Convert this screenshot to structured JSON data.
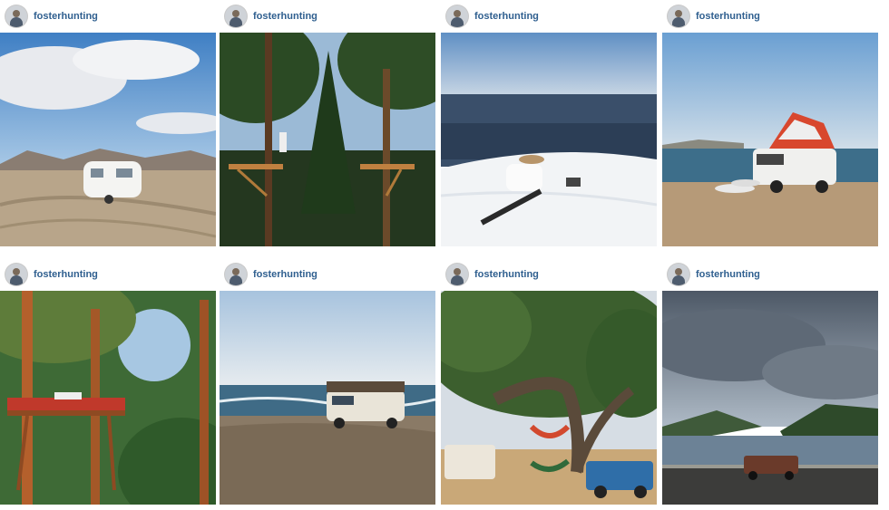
{
  "feed": {
    "posts": [
      {
        "username": "fosterhunting",
        "photo_subject": "vintage-camper-trailer"
      },
      {
        "username": "fosterhunting",
        "photo_subject": "treehouse-platforms"
      },
      {
        "username": "fosterhunting",
        "photo_subject": "snowboarder-on-summit"
      },
      {
        "username": "fosterhunting",
        "photo_subject": "van-rooftop-tent-beach"
      },
      {
        "username": "fosterhunting",
        "photo_subject": "forest-treehouse-deck"
      },
      {
        "username": "fosterhunting",
        "photo_subject": "vw-van-surf-beach"
      },
      {
        "username": "fosterhunting",
        "photo_subject": "hammocks-oak-tree"
      },
      {
        "username": "fosterhunting",
        "photo_subject": "truck-river-gorge"
      }
    ]
  },
  "colors": {
    "username": "#2f5f8f",
    "background": "#ffffff"
  }
}
